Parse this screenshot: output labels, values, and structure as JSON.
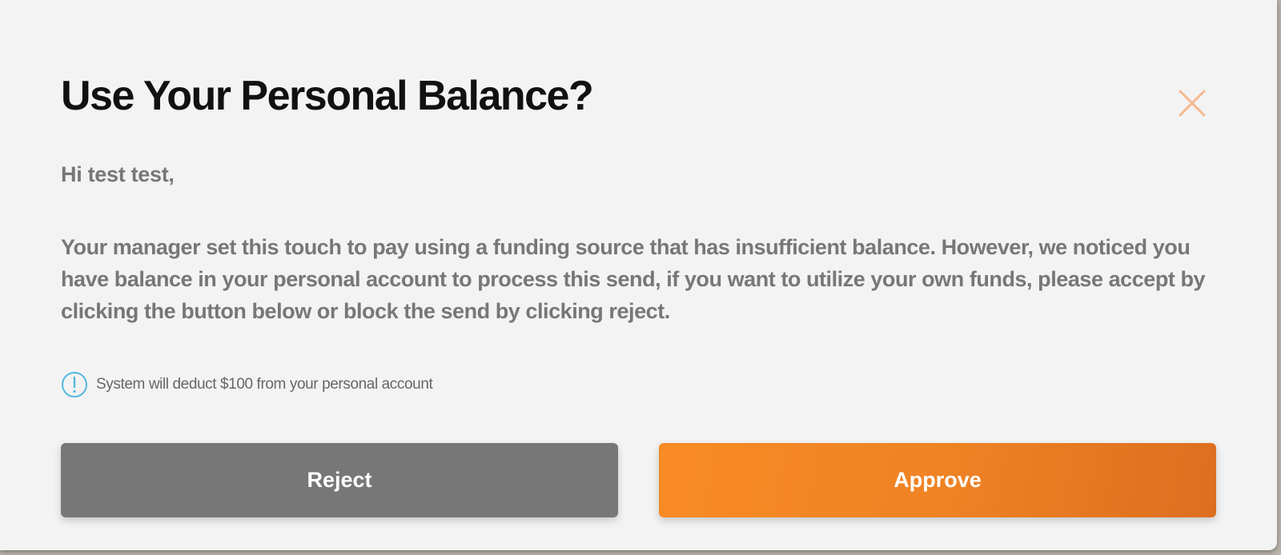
{
  "dialog": {
    "title": "Use Your Personal Balance?",
    "greeting": "Hi test test,",
    "message": "Your manager set this touch to pay using a funding source that has insufficient balance. However, we noticed you have balance in your personal account to process this send, if you want to utilize your own funds, please accept by clicking the button below or block the send by clicking reject.",
    "notice": "System will deduct $100 from your personal account",
    "close_icon": "close-icon",
    "notice_icon": "info-circle-icon",
    "buttons": {
      "reject_label": "Reject",
      "approve_label": "Approve"
    }
  },
  "colors": {
    "accent": "#f48020",
    "close_icon": "#f5b890",
    "info_icon": "#55b8e0",
    "reject_button": "#777777",
    "title_text": "#111111",
    "body_text": "#777777"
  }
}
